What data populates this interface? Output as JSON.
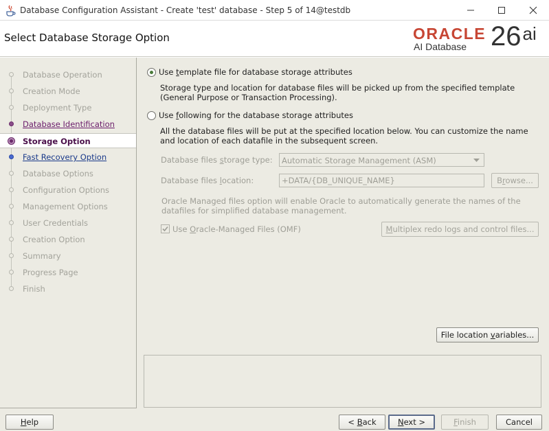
{
  "window": {
    "title": "Database Configuration Assistant - Create 'test' database - Step 5 of 14@testdb"
  },
  "header": {
    "page_title": "Select Database Storage Option",
    "brand_word": "ORACLE",
    "brand_sub": "AI Database",
    "brand_version": "26",
    "brand_version_suffix": "ai"
  },
  "sidebar": {
    "steps": [
      {
        "label": "Database Operation",
        "state": "disabled"
      },
      {
        "label": "Creation Mode",
        "state": "disabled"
      },
      {
        "label": "Deployment Type",
        "state": "disabled"
      },
      {
        "label": "Database Identification",
        "state": "visited"
      },
      {
        "label": "Storage Option",
        "state": "current"
      },
      {
        "label": "Fast Recovery Option",
        "state": "link"
      },
      {
        "label": "Database Options",
        "state": "disabled"
      },
      {
        "label": "Configuration Options",
        "state": "disabled"
      },
      {
        "label": "Management Options",
        "state": "disabled"
      },
      {
        "label": "User Credentials",
        "state": "disabled"
      },
      {
        "label": "Creation Option",
        "state": "disabled"
      },
      {
        "label": "Summary",
        "state": "disabled"
      },
      {
        "label": "Progress Page",
        "state": "disabled"
      },
      {
        "label": "Finish",
        "state": "disabled"
      }
    ]
  },
  "main": {
    "option_template": {
      "pre": "Use ",
      "mnemonic": "t",
      "post": "emplate file for database storage attributes",
      "desc_line1": "Storage type and location for database files will be picked up from the specified template",
      "desc_line2": "(General Purpose or Transaction Processing).",
      "selected": true
    },
    "option_following": {
      "pre": "Use ",
      "mnemonic": "f",
      "post": "ollowing for the database storage attributes",
      "desc_line1": "All the database files will be put at the specified location below. You can customize the name",
      "desc_line2": "and location of each datafile in the subsequent screen.",
      "selected": false
    },
    "storage_type": {
      "label_pre": "Database files ",
      "label_mnemonic": "s",
      "label_post": "torage type:",
      "value": "Automatic Storage Management (ASM)"
    },
    "files_location": {
      "label_pre": "Database files ",
      "label_mnemonic": "l",
      "label_post": "ocation:",
      "value": "+DATA/{DB_UNIQUE_NAME}"
    },
    "browse_button": {
      "pre": "B",
      "mnemonic": "r",
      "post": "owse..."
    },
    "omf_note_line1": "Oracle Managed files option will enable Oracle to automatically generate the names of the",
    "omf_note_line2": "datafiles for simplified database management.",
    "omf_checkbox": {
      "pre": "Use ",
      "mnemonic": "O",
      "post": "racle-Managed Files (OMF)",
      "checked": true
    },
    "multiplex_button": {
      "mnemonic": "M",
      "post": "ultiplex redo logs and control files..."
    },
    "file_location_vars_button": {
      "pre": "File location ",
      "mnemonic": "v",
      "post": "ariables..."
    }
  },
  "footer": {
    "help": {
      "mnemonic": "H",
      "post": "elp"
    },
    "back": {
      "pre": "< ",
      "mnemonic": "B",
      "post": "ack"
    },
    "next": {
      "mnemonic": "N",
      "post": "ext >"
    },
    "finish": {
      "mnemonic": "F",
      "post": "inish"
    },
    "cancel": {
      "label": "Cancel"
    }
  },
  "colors": {
    "brand_red": "#C74634",
    "current_step": "#4A0F4A",
    "visited_step": "#6A1B6A",
    "link_step": "#1A3A8A",
    "panel_bg": "#ECEBE3"
  },
  "icons": [
    "java-app-icon",
    "minimize-icon",
    "maximize-icon",
    "close-icon",
    "dropdown-arrow-icon",
    "checkmark-icon"
  ]
}
